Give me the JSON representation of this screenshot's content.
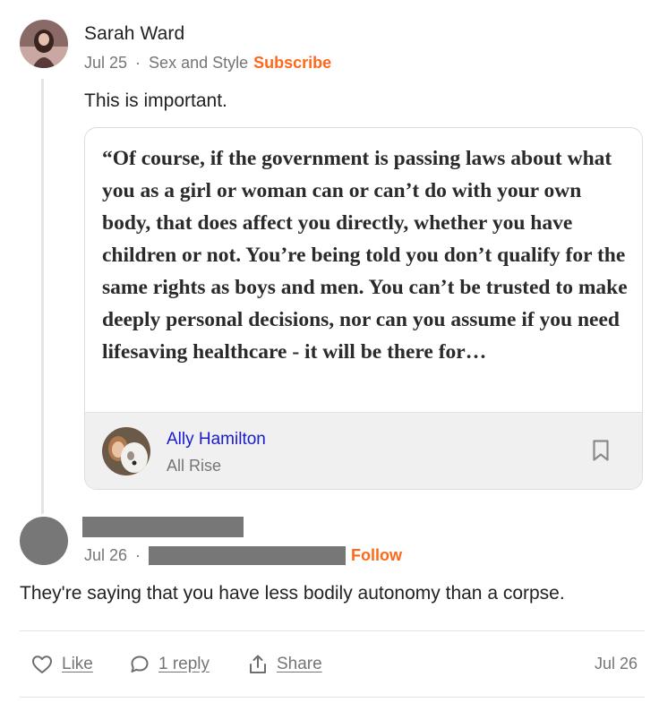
{
  "comment_1": {
    "author": "Sarah Ward",
    "date": "Jul 25",
    "separator": "·",
    "publication": "Sex and Style",
    "subscribe_label": "Subscribe",
    "text": "This is important."
  },
  "quote": {
    "text": "“Of course, if the government is passing laws about what you as a girl or woman can or can’t do with your own body, that does affect you directly, whether you have children or not. You’re being told you don’t qualify for the same rights as boys and men. You can’t be trusted to make deeply personal decisions, nor can you assume if you need lifesaving healthcare - it will be there for…",
    "author": "Ally Hamilton",
    "publication": "All Rise",
    "bookmark_icon": "bookmark-icon"
  },
  "comment_2": {
    "date": "Jul 26",
    "separator": "·",
    "follow_label": "Follow",
    "text": "They're saying that you have less bodily autonomy than a corpse."
  },
  "actions": {
    "like_label": "Like",
    "reply_label": "1 reply",
    "share_label": "Share",
    "date": "Jul 26",
    "icons": [
      "heart-icon",
      "comment-icon",
      "share-icon"
    ]
  },
  "colors": {
    "accent": "#ff6719",
    "link_blue": "#1a1ad0",
    "muted": "#757575",
    "redaction": "#777777"
  }
}
